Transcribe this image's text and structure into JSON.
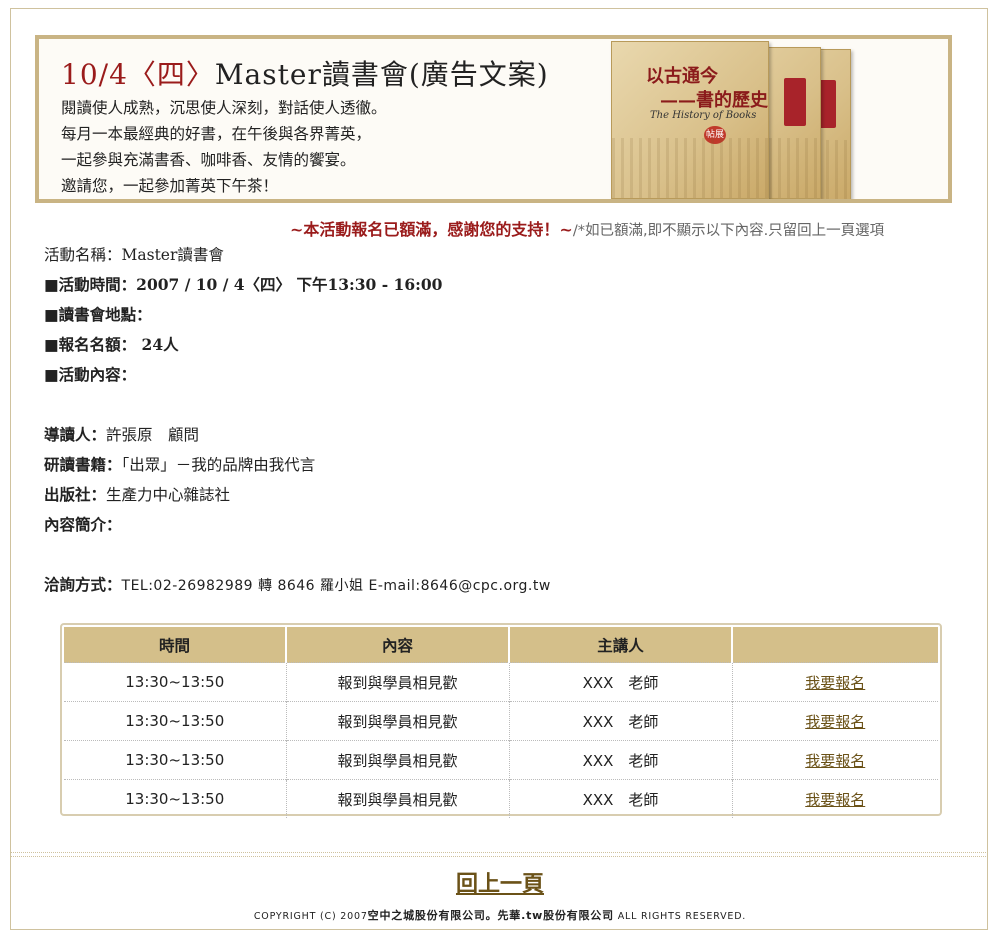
{
  "banner": {
    "title_date": "10/4〈四〉",
    "title_rest": "Master讀書會(廣告文案)",
    "lines": [
      "閱讀使人成熟，沉思使人深刻，對話使人透徹。",
      "每月一本最經典的好書，在午後與各界菁英，",
      "一起參與充滿書香、咖啡香、友情的饗宴。",
      "邀請您，一起參加菁英下午茶！"
    ],
    "book": {
      "cover_title_line1": "以古通今",
      "cover_title_line2": "——書的歷史",
      "cover_subtitle": "The History of Books",
      "seal": "帖展"
    }
  },
  "notice": {
    "full_text": "~本活動報名已額滿，感謝您的支持！~",
    "note_text": "/*如已額滿,即不顯示以下內容.只留回上一頁選項"
  },
  "info": {
    "activity_name_label": "活動名稱：",
    "activity_name_value": "Master讀書會",
    "time_label": "■活動時間：",
    "time_value": "2007 / 10 / 4〈四〉 下午13:30 - 16:00",
    "location_label": "■讀書會地點：",
    "location_value": "",
    "quota_label": "■報名名額：",
    "quota_value": " 24人",
    "content_label": "■活動內容：",
    "guide_label": "導讀人：",
    "guide_value": "許張原　顧問",
    "book_label": "研讀書籍：",
    "book_value": "「出眾」－我的品牌由我代言",
    "publisher_label": "出版社：",
    "publisher_value": "生產力中心雜誌社",
    "summary_label": "內容簡介：",
    "contact_label": "洽詢方式：",
    "contact_value": "TEL:02-26982989 轉 8646 羅小姐 E-mail:8646@cpc.org.tw"
  },
  "table": {
    "headers": [
      "時間",
      "內容",
      "主講人",
      ""
    ],
    "rows": [
      {
        "time": "13:30~13:50",
        "content": "報到與學員相見歡",
        "speaker": "XXX　老師",
        "action": "我要報名"
      },
      {
        "time": "13:30~13:50",
        "content": "報到與學員相見歡",
        "speaker": "XXX　老師",
        "action": "我要報名"
      },
      {
        "time": "13:30~13:50",
        "content": "報到與學員相見歡",
        "speaker": "XXX　老師",
        "action": "我要報名"
      },
      {
        "time": "13:30~13:50",
        "content": "報到與學員相見歡",
        "speaker": "XXX　老師",
        "action": "我要報名"
      }
    ]
  },
  "footer": {
    "back_label": "回上一頁",
    "copyright_prefix": "COPYRIGHT (C) 2007",
    "company1": "空中之城股份有限公司",
    "dot": "。",
    "company2": "先華.tw股份有限公司",
    "copyright_suffix": " ALL RIGHTS RESERVED."
  },
  "colors": {
    "accent_red": "#9a1b1b",
    "gold_header": "#d4bf8a",
    "border_gold": "#c9b484",
    "link_brown": "#6b5218"
  }
}
